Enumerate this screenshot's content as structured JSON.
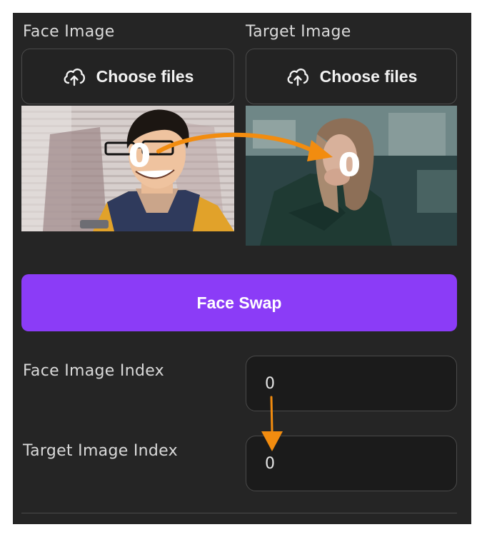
{
  "face_image": {
    "label": "Face Image",
    "button_label": "Choose files",
    "overlay_index": "0"
  },
  "target_image": {
    "label": "Target Image",
    "button_label": "Choose files",
    "overlay_index": "0"
  },
  "actions": {
    "swap_label": "Face Swap"
  },
  "inputs": {
    "face_index": {
      "label": "Face Image Index",
      "value": "0"
    },
    "target_index": {
      "label": "Target Image Index",
      "value": "0"
    }
  },
  "annotations": {
    "arrow_color": "#f28c0f"
  },
  "colors": {
    "panel": "#252525",
    "accent": "#8b3cf7",
    "text": "#d9d9d9"
  },
  "icons": {
    "upload": "cloud-upload-icon"
  }
}
